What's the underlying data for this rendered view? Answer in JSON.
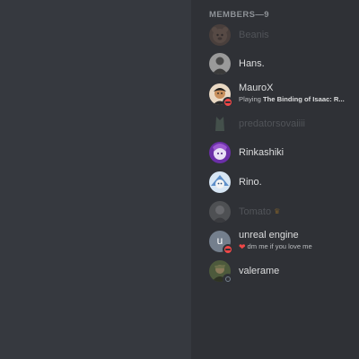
{
  "members_header": "MEMBERS—9",
  "members": [
    {
      "name": "Beanis"
    },
    {
      "name": "Hans."
    },
    {
      "name": "MauroX",
      "activity_prefix": "Playing ",
      "activity_game": "The Binding of Isaac: R..."
    },
    {
      "name": "predatorsovaiiii"
    },
    {
      "name": "Rinkashiki"
    },
    {
      "name": "Rino."
    },
    {
      "name": "Tomato",
      "badge": "owner-crown-icon"
    },
    {
      "name": "unreal engine",
      "avatar_letter": "u",
      "custom_status": "dm me if you love me",
      "status_emoji": "heart-icon"
    },
    {
      "name": "valerame"
    }
  ],
  "colors": {
    "background": "#36393f",
    "sidebar": "#2f3136",
    "header_text": "#8e9297",
    "name_text": "#dcddde",
    "dnd": "#f04747",
    "crown": "#faa61a",
    "default_avatar": "#747f8d"
  }
}
